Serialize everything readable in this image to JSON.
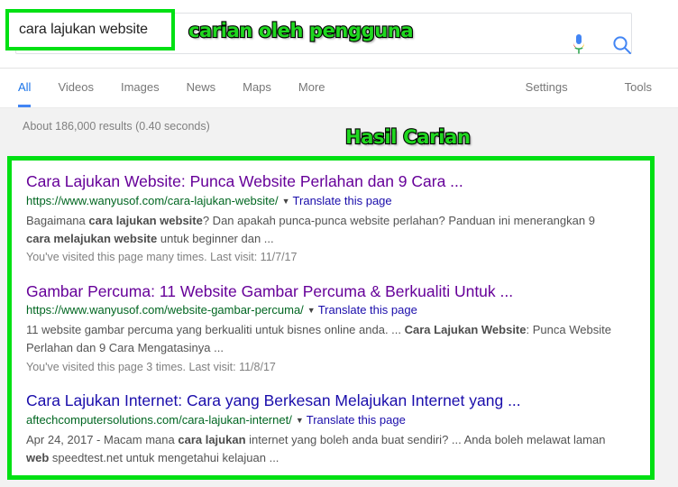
{
  "search": {
    "query": "cara lajukan website",
    "mic_icon": "microphone-icon",
    "search_icon": "magnifier-icon"
  },
  "annotations": {
    "query_label": "carian oleh pengguna",
    "results_label": "Hasil Carian",
    "highlight_color": "#00e013",
    "text_color": "#20d820"
  },
  "nav": {
    "tabs": [
      {
        "label": "All",
        "active": true
      },
      {
        "label": "Videos",
        "active": false
      },
      {
        "label": "Images",
        "active": false
      },
      {
        "label": "News",
        "active": false
      },
      {
        "label": "Maps",
        "active": false
      },
      {
        "label": "More",
        "active": false
      }
    ],
    "right": [
      {
        "label": "Settings"
      },
      {
        "label": "Tools"
      }
    ]
  },
  "stats": "About 186,000 results (0.40 seconds)",
  "results": [
    {
      "title": "Cara Lajukan Website: Punca Website Perlahan dan 9 Cara ...",
      "visited": true,
      "url": "https://www.wanyusof.com/cara-lajukan-website/",
      "translate": "Translate this page",
      "snippet_parts": [
        {
          "text": "Bagaimana ",
          "bold": false
        },
        {
          "text": "cara lajukan website",
          "bold": true
        },
        {
          "text": "? Dan apakah punca-punca website perlahan? Panduan ini menerangkan 9 ",
          "bold": false
        },
        {
          "text": "cara melajukan website",
          "bold": true
        },
        {
          "text": " untuk beginner dan ...",
          "bold": false
        }
      ],
      "visit_note": "You've visited this page many times. Last visit: 11/7/17"
    },
    {
      "title": "Gambar Percuma: 11 Website Gambar Percuma & Berkualiti Untuk ...",
      "visited": true,
      "url": "https://www.wanyusof.com/website-gambar-percuma/",
      "translate": "Translate this page",
      "snippet_parts": [
        {
          "text": "11 website gambar percuma yang berkualiti untuk bisnes online anda. ... ",
          "bold": false
        },
        {
          "text": "Cara Lajukan Website",
          "bold": true
        },
        {
          "text": ": Punca Website Perlahan dan 9 Cara Mengatasinya ...",
          "bold": false
        }
      ],
      "visit_note": "You've visited this page 3 times. Last visit: 11/8/17"
    },
    {
      "title": "Cara Lajukan Internet: Cara yang Berkesan Melajukan Internet yang ...",
      "visited": false,
      "url": "aftechcomputersolutions.com/cara-lajukan-internet/",
      "translate": "Translate this page",
      "snippet_parts": [
        {
          "text": "Apr 24, 2017 - Macam mana ",
          "bold": false
        },
        {
          "text": "cara lajukan",
          "bold": true
        },
        {
          "text": " internet yang boleh anda buat sendiri? ... Anda boleh melawat laman ",
          "bold": false
        },
        {
          "text": "web",
          "bold": true
        },
        {
          "text": " speedtest.net untuk mengetahui kelajuan ...",
          "bold": false
        }
      ],
      "visit_note": ""
    }
  ]
}
